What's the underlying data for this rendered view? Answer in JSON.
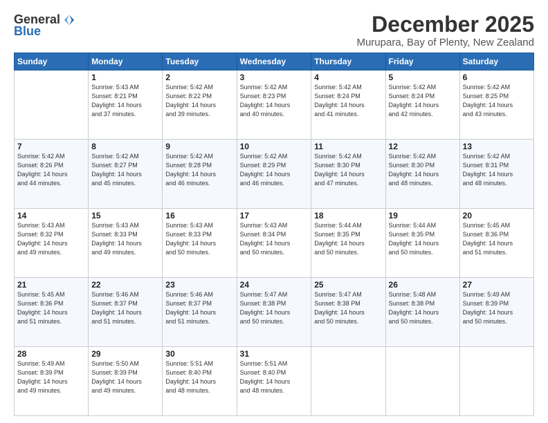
{
  "logo": {
    "general": "General",
    "blue": "Blue"
  },
  "title": "December 2025",
  "location": "Murupara, Bay of Plenty, New Zealand",
  "days_header": [
    "Sunday",
    "Monday",
    "Tuesday",
    "Wednesday",
    "Thursday",
    "Friday",
    "Saturday"
  ],
  "weeks": [
    [
      {
        "day": "",
        "info": ""
      },
      {
        "day": "1",
        "info": "Sunrise: 5:43 AM\nSunset: 8:21 PM\nDaylight: 14 hours\nand 37 minutes."
      },
      {
        "day": "2",
        "info": "Sunrise: 5:42 AM\nSunset: 8:22 PM\nDaylight: 14 hours\nand 39 minutes."
      },
      {
        "day": "3",
        "info": "Sunrise: 5:42 AM\nSunset: 8:23 PM\nDaylight: 14 hours\nand 40 minutes."
      },
      {
        "day": "4",
        "info": "Sunrise: 5:42 AM\nSunset: 8:24 PM\nDaylight: 14 hours\nand 41 minutes."
      },
      {
        "day": "5",
        "info": "Sunrise: 5:42 AM\nSunset: 8:24 PM\nDaylight: 14 hours\nand 42 minutes."
      },
      {
        "day": "6",
        "info": "Sunrise: 5:42 AM\nSunset: 8:25 PM\nDaylight: 14 hours\nand 43 minutes."
      }
    ],
    [
      {
        "day": "7",
        "info": "Sunrise: 5:42 AM\nSunset: 8:26 PM\nDaylight: 14 hours\nand 44 minutes."
      },
      {
        "day": "8",
        "info": "Sunrise: 5:42 AM\nSunset: 8:27 PM\nDaylight: 14 hours\nand 45 minutes."
      },
      {
        "day": "9",
        "info": "Sunrise: 5:42 AM\nSunset: 8:28 PM\nDaylight: 14 hours\nand 46 minutes."
      },
      {
        "day": "10",
        "info": "Sunrise: 5:42 AM\nSunset: 8:29 PM\nDaylight: 14 hours\nand 46 minutes."
      },
      {
        "day": "11",
        "info": "Sunrise: 5:42 AM\nSunset: 8:30 PM\nDaylight: 14 hours\nand 47 minutes."
      },
      {
        "day": "12",
        "info": "Sunrise: 5:42 AM\nSunset: 8:30 PM\nDaylight: 14 hours\nand 48 minutes."
      },
      {
        "day": "13",
        "info": "Sunrise: 5:42 AM\nSunset: 8:31 PM\nDaylight: 14 hours\nand 48 minutes."
      }
    ],
    [
      {
        "day": "14",
        "info": "Sunrise: 5:43 AM\nSunset: 8:32 PM\nDaylight: 14 hours\nand 49 minutes."
      },
      {
        "day": "15",
        "info": "Sunrise: 5:43 AM\nSunset: 8:33 PM\nDaylight: 14 hours\nand 49 minutes."
      },
      {
        "day": "16",
        "info": "Sunrise: 5:43 AM\nSunset: 8:33 PM\nDaylight: 14 hours\nand 50 minutes."
      },
      {
        "day": "17",
        "info": "Sunrise: 5:43 AM\nSunset: 8:34 PM\nDaylight: 14 hours\nand 50 minutes."
      },
      {
        "day": "18",
        "info": "Sunrise: 5:44 AM\nSunset: 8:35 PM\nDaylight: 14 hours\nand 50 minutes."
      },
      {
        "day": "19",
        "info": "Sunrise: 5:44 AM\nSunset: 8:35 PM\nDaylight: 14 hours\nand 50 minutes."
      },
      {
        "day": "20",
        "info": "Sunrise: 5:45 AM\nSunset: 8:36 PM\nDaylight: 14 hours\nand 51 minutes."
      }
    ],
    [
      {
        "day": "21",
        "info": "Sunrise: 5:45 AM\nSunset: 8:36 PM\nDaylight: 14 hours\nand 51 minutes."
      },
      {
        "day": "22",
        "info": "Sunrise: 5:46 AM\nSunset: 8:37 PM\nDaylight: 14 hours\nand 51 minutes."
      },
      {
        "day": "23",
        "info": "Sunrise: 5:46 AM\nSunset: 8:37 PM\nDaylight: 14 hours\nand 51 minutes."
      },
      {
        "day": "24",
        "info": "Sunrise: 5:47 AM\nSunset: 8:38 PM\nDaylight: 14 hours\nand 50 minutes."
      },
      {
        "day": "25",
        "info": "Sunrise: 5:47 AM\nSunset: 8:38 PM\nDaylight: 14 hours\nand 50 minutes."
      },
      {
        "day": "26",
        "info": "Sunrise: 5:48 AM\nSunset: 8:38 PM\nDaylight: 14 hours\nand 50 minutes."
      },
      {
        "day": "27",
        "info": "Sunrise: 5:49 AM\nSunset: 8:39 PM\nDaylight: 14 hours\nand 50 minutes."
      }
    ],
    [
      {
        "day": "28",
        "info": "Sunrise: 5:49 AM\nSunset: 8:39 PM\nDaylight: 14 hours\nand 49 minutes."
      },
      {
        "day": "29",
        "info": "Sunrise: 5:50 AM\nSunset: 8:39 PM\nDaylight: 14 hours\nand 49 minutes."
      },
      {
        "day": "30",
        "info": "Sunrise: 5:51 AM\nSunset: 8:40 PM\nDaylight: 14 hours\nand 48 minutes."
      },
      {
        "day": "31",
        "info": "Sunrise: 5:51 AM\nSunset: 8:40 PM\nDaylight: 14 hours\nand 48 minutes."
      },
      {
        "day": "",
        "info": ""
      },
      {
        "day": "",
        "info": ""
      },
      {
        "day": "",
        "info": ""
      }
    ]
  ]
}
